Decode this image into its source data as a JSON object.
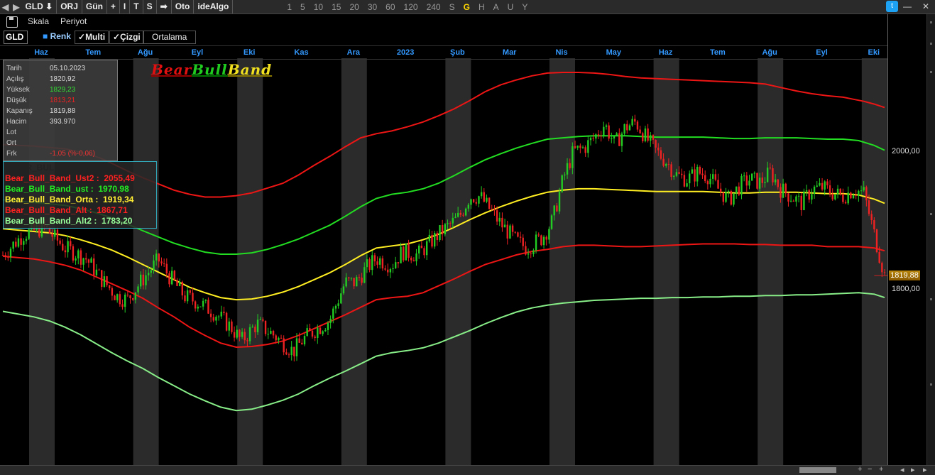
{
  "topbar": {
    "nav_icons": [
      "◀",
      "▶"
    ],
    "symbol": "GLD",
    "symbol_dropdown_icon": "⬇",
    "items": [
      "ORJ",
      "Gün",
      "+",
      "I",
      "T",
      "S",
      "➡",
      "Oto",
      "ideAlgo"
    ],
    "periods": [
      "1",
      "5",
      "10",
      "15",
      "20",
      "30",
      "60",
      "120",
      "240",
      "S",
      "G",
      "H",
      "A",
      "U",
      "Y"
    ],
    "active_period": "G"
  },
  "menu": {
    "scale_label": "Skala",
    "period_label": "Periyot"
  },
  "toolbar": {
    "symbol": "GLD",
    "color_label": "Renk",
    "multi_label": "Multi",
    "line_label": "Çizgi",
    "avg_label": "Ortalama"
  },
  "info_panel": {
    "rows": [
      {
        "label": "Tarih",
        "value": "05.10.2023",
        "color": "#dddddd"
      },
      {
        "label": "Açılış",
        "value": "1820,92",
        "color": "#dddddd"
      },
      {
        "label": "Yüksek",
        "value": "1829,23",
        "color": "#33dd33"
      },
      {
        "label": "Düşük",
        "value": "1813,21",
        "color": "#ee2222"
      },
      {
        "label": "Kapanış",
        "value": "1819,88",
        "color": "#dddddd"
      },
      {
        "label": "Hacim",
        "value": "393.970",
        "color": "#dddddd"
      },
      {
        "label": "Lot",
        "value": "",
        "color": "#dddddd"
      },
      {
        "label": "Ort",
        "value": "",
        "color": "#dddddd"
      },
      {
        "label": "Frk",
        "value": "-1,05 (%-0,06)",
        "color": "#ee3333"
      }
    ]
  },
  "logo": {
    "part1": "Bear",
    "part2": "Bull",
    "part3": "Band"
  },
  "legend": {
    "title": "BEAR_BULL_BAND",
    "items": [
      {
        "label": "Bear_Bull_Band_Ust2 :  2055,49",
        "color": "#ff2020"
      },
      {
        "label": "Bear_Bull_Band_ust :  1970,98",
        "color": "#22ee22"
      },
      {
        "label": "Bear_Bull_Band_Orta :  1919,34",
        "color": "#ffee33"
      },
      {
        "label": "Bear_Bull_Band_Alt :  1867,71",
        "color": "#ff2020"
      },
      {
        "label": "Bear_Bull_Band_Alt2 :  1783,20",
        "color": "#99ff99"
      }
    ]
  },
  "price_axis": {
    "labels": [
      {
        "text": "2000,00",
        "value": 2000
      },
      {
        "text": "1800,00",
        "value": 1800
      }
    ],
    "current": "1819,88"
  },
  "chart_data": {
    "type": "line",
    "title": "",
    "months": [
      "Haz",
      "Tem",
      "Ağu",
      "Eyl",
      "Eki",
      "Kas",
      "Ara",
      "2023",
      "Şub",
      "Mar",
      "Nis",
      "May",
      "Haz",
      "Tem",
      "Ağu",
      "Eyl",
      "Eki"
    ],
    "ylim": [
      1620,
      2130
    ],
    "series": [
      {
        "name": "Bear_Bull_Band_Ust2",
        "color": "#ee1515",
        "x": [
          0,
          3,
          6,
          9,
          12,
          15,
          17,
          19,
          21,
          24,
          27,
          30,
          33,
          36,
          39,
          42,
          45,
          48,
          51,
          54,
          57,
          60,
          63,
          66,
          69,
          72,
          75,
          78,
          81,
          84,
          87,
          90,
          93,
          96,
          99,
          102,
          105,
          108,
          111,
          114,
          117,
          120,
          123,
          126,
          129,
          132,
          135,
          138,
          141,
          144,
          147,
          150,
          153,
          156,
          159,
          162,
          164,
          166,
          168,
          170
        ],
        "y": [
          2010,
          2009,
          2008,
          2006,
          2004,
          1999,
          1995,
          1990,
          1983,
          1972,
          1962,
          1953,
          1944,
          1938,
          1934,
          1934,
          1936,
          1940,
          1947,
          1954,
          1966,
          1980,
          1993,
          2007,
          2020,
          2026,
          2030,
          2036,
          2043,
          2052,
          2062,
          2074,
          2087,
          2097,
          2104,
          2110,
          2114,
          2115,
          2115,
          2114,
          2112,
          2109,
          2107,
          2106,
          2105,
          2104,
          2103,
          2102,
          2101,
          2100,
          2098,
          2093,
          2088,
          2084,
          2081,
          2079,
          2076,
          2073,
          2069,
          2064
        ]
      },
      {
        "name": "Bear_Bull_Band_ust",
        "color": "#22dd22",
        "x": [
          0,
          3,
          6,
          9,
          12,
          15,
          18,
          21,
          24,
          27,
          30,
          33,
          36,
          39,
          42,
          45,
          48,
          51,
          54,
          57,
          60,
          63,
          66,
          69,
          72,
          75,
          78,
          81,
          84,
          87,
          90,
          93,
          96,
          99,
          102,
          105,
          108,
          111,
          114,
          117,
          120,
          123,
          126,
          129,
          132,
          135,
          138,
          141,
          144,
          147,
          150,
          153,
          156,
          159,
          162,
          165,
          168,
          170
        ],
        "y": [
          1930,
          1928,
          1926,
          1924,
          1922,
          1917,
          1911,
          1904,
          1895,
          1885,
          1876,
          1867,
          1860,
          1854,
          1851,
          1851,
          1853,
          1858,
          1865,
          1873,
          1883,
          1893,
          1906,
          1920,
          1932,
          1938,
          1941,
          1946,
          1954,
          1965,
          1977,
          1988,
          1997,
          2005,
          2012,
          2018,
          2020,
          2022,
          2023,
          2023,
          2023,
          2022,
          2021,
          2021,
          2021,
          2021,
          2020,
          2019,
          2019,
          2020,
          2020,
          2020,
          2019,
          2018,
          2018,
          2016,
          2009,
          2002
        ]
      },
      {
        "name": "Bear_Bull_Band_Orta",
        "color": "#ffee22",
        "x": [
          0,
          3,
          6,
          9,
          12,
          15,
          18,
          21,
          24,
          27,
          30,
          33,
          36,
          39,
          42,
          45,
          48,
          51,
          54,
          57,
          60,
          63,
          66,
          69,
          72,
          75,
          78,
          81,
          84,
          87,
          90,
          93,
          96,
          99,
          102,
          105,
          108,
          111,
          114,
          117,
          120,
          123,
          126,
          129,
          132,
          135,
          138,
          141,
          144,
          147,
          150,
          153,
          156,
          159,
          162,
          165,
          168,
          170
        ],
        "y": [
          1888,
          1886,
          1884,
          1882,
          1878,
          1872,
          1865,
          1857,
          1847,
          1836,
          1825,
          1814,
          1803,
          1795,
          1788,
          1785,
          1786,
          1790,
          1796,
          1804,
          1814,
          1824,
          1836,
          1849,
          1860,
          1863,
          1866,
          1872,
          1880,
          1890,
          1901,
          1911,
          1920,
          1928,
          1935,
          1941,
          1944,
          1946,
          1946,
          1945,
          1944,
          1943,
          1942,
          1942,
          1942,
          1942,
          1941,
          1940,
          1940,
          1941,
          1941,
          1941,
          1940,
          1939,
          1939,
          1937,
          1931,
          1925
        ]
      },
      {
        "name": "Bear_Bull_Band_Alt",
        "color": "#ee1515",
        "x": [
          0,
          3,
          6,
          9,
          12,
          15,
          18,
          21,
          24,
          27,
          30,
          33,
          36,
          39,
          42,
          45,
          48,
          51,
          54,
          57,
          60,
          63,
          66,
          69,
          72,
          75,
          78,
          81,
          84,
          87,
          90,
          93,
          96,
          99,
          102,
          105,
          108,
          111,
          114,
          117,
          120,
          123,
          126,
          129,
          132,
          135,
          138,
          141,
          144,
          147,
          150,
          153,
          156,
          159,
          162,
          165,
          168,
          170
        ],
        "y": [
          1848,
          1846,
          1844,
          1840,
          1835,
          1828,
          1818,
          1808,
          1798,
          1787,
          1773,
          1760,
          1745,
          1733,
          1722,
          1716,
          1717,
          1720,
          1725,
          1733,
          1743,
          1753,
          1763,
          1774,
          1785,
          1788,
          1790,
          1795,
          1805,
          1815,
          1826,
          1836,
          1843,
          1850,
          1855,
          1858,
          1862,
          1864,
          1864,
          1863,
          1862,
          1862,
          1863,
          1864,
          1865,
          1866,
          1866,
          1866,
          1865,
          1865,
          1864,
          1864,
          1864,
          1862,
          1862,
          1862,
          1860,
          1856
        ]
      },
      {
        "name": "Bear_Bull_Band_Alt2",
        "color": "#88ee88",
        "x": [
          0,
          3,
          6,
          9,
          12,
          15,
          18,
          21,
          24,
          27,
          30,
          33,
          36,
          39,
          42,
          45,
          48,
          51,
          54,
          57,
          60,
          63,
          66,
          69,
          72,
          75,
          78,
          81,
          84,
          87,
          90,
          93,
          96,
          99,
          102,
          105,
          108,
          111,
          114,
          117,
          120,
          123,
          126,
          129,
          132,
          135,
          138,
          141,
          144,
          147,
          150,
          153,
          156,
          159,
          162,
          165,
          168,
          170
        ],
        "y": [
          1768,
          1764,
          1760,
          1754,
          1745,
          1734,
          1721,
          1708,
          1696,
          1685,
          1672,
          1660,
          1648,
          1638,
          1629,
          1624,
          1626,
          1632,
          1639,
          1648,
          1660,
          1671,
          1681,
          1692,
          1703,
          1708,
          1711,
          1715,
          1722,
          1731,
          1740,
          1750,
          1759,
          1767,
          1773,
          1777,
          1780,
          1782,
          1784,
          1785,
          1786,
          1787,
          1787,
          1788,
          1788,
          1789,
          1789,
          1790,
          1790,
          1791,
          1791,
          1792,
          1792,
          1793,
          1794,
          1795,
          1793,
          1788
        ]
      }
    ],
    "candles": {
      "up_color": "#22cc22",
      "down_color": "#ee2222",
      "close_path": [
        [
          0,
          1850
        ],
        [
          4,
          1880
        ],
        [
          8,
          1890
        ],
        [
          12,
          1860
        ],
        [
          16,
          1845
        ],
        [
          19,
          1815
        ],
        [
          22,
          1790
        ],
        [
          24,
          1785
        ],
        [
          27,
          1815
        ],
        [
          30,
          1843
        ],
        [
          32,
          1820
        ],
        [
          35,
          1790
        ],
        [
          38,
          1780
        ],
        [
          41,
          1765
        ],
        [
          44,
          1745
        ],
        [
          46,
          1725
        ],
        [
          49,
          1750
        ],
        [
          52,
          1735
        ],
        [
          56,
          1710
        ],
        [
          58,
          1728
        ],
        [
          60,
          1740
        ],
        [
          63,
          1755
        ],
        [
          66,
          1810
        ],
        [
          68,
          1810
        ],
        [
          70,
          1830
        ],
        [
          72,
          1845
        ],
        [
          75,
          1835
        ],
        [
          77,
          1855
        ],
        [
          80,
          1850
        ],
        [
          84,
          1880
        ],
        [
          88,
          1905
        ],
        [
          90,
          1935
        ],
        [
          92,
          1935
        ],
        [
          94,
          1915
        ],
        [
          96,
          1895
        ],
        [
          99,
          1870
        ],
        [
          101,
          1860
        ],
        [
          104,
          1875
        ],
        [
          106,
          1900
        ],
        [
          108,
          1960
        ],
        [
          110,
          2000
        ],
        [
          112,
          2005
        ],
        [
          114,
          2020
        ],
        [
          116,
          2040
        ],
        [
          118,
          2010
        ],
        [
          120,
          2035
        ],
        [
          122,
          2043
        ],
        [
          124,
          2020
        ],
        [
          126,
          2000
        ],
        [
          128,
          1985
        ],
        [
          130,
          1965
        ],
        [
          132,
          1960
        ],
        [
          134,
          1970
        ],
        [
          136,
          1965
        ],
        [
          138,
          1945
        ],
        [
          140,
          1930
        ],
        [
          142,
          1950
        ],
        [
          144,
          1960
        ],
        [
          146,
          1955
        ],
        [
          148,
          1970
        ],
        [
          150,
          1945
        ],
        [
          152,
          1935
        ],
        [
          154,
          1925
        ],
        [
          156,
          1945
        ],
        [
          158,
          1948
        ],
        [
          160,
          1940
        ],
        [
          162,
          1935
        ],
        [
          164,
          1945
        ],
        [
          166,
          1940
        ],
        [
          168,
          1880
        ],
        [
          170,
          1820
        ]
      ]
    }
  }
}
